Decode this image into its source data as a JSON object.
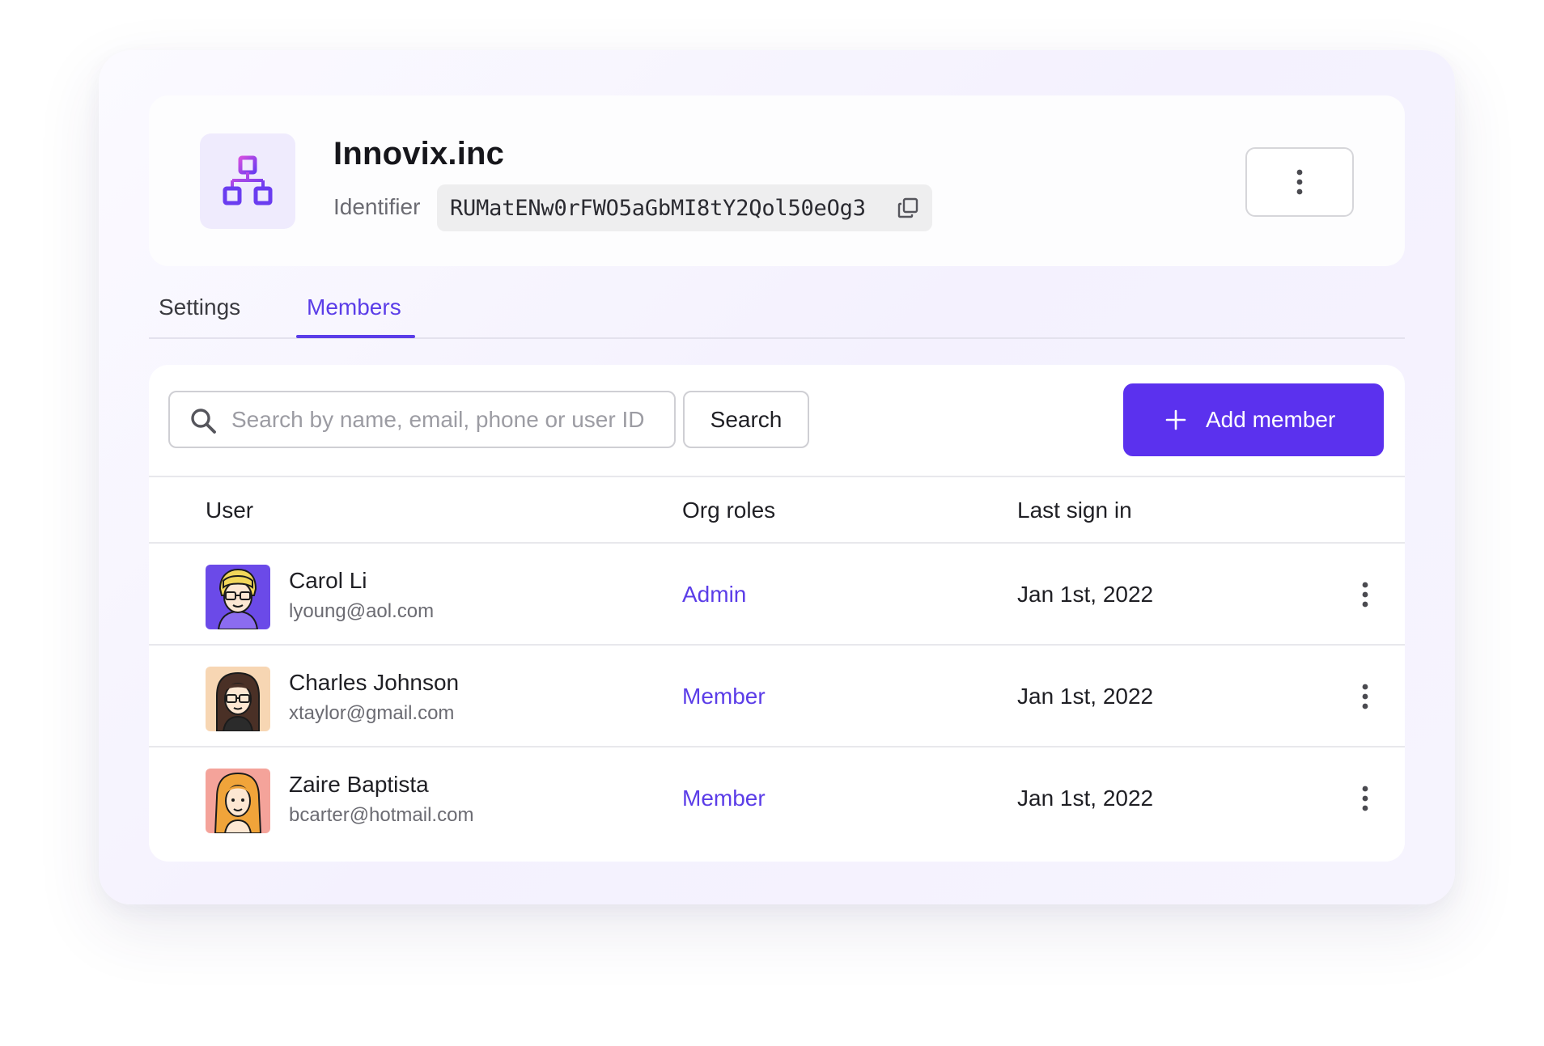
{
  "org": {
    "name": "Innovix.inc",
    "identifier_label": "Identifier",
    "identifier_value": "RUMatENw0rFWO5aGbMI8tY2Qol50eOg3",
    "logo_icon": "org-hierarchy-icon"
  },
  "tabs": [
    {
      "label": "Settings",
      "active": false
    },
    {
      "label": "Members",
      "active": true
    }
  ],
  "toolbar": {
    "search_placeholder": "Search by name, email, phone or user ID",
    "search_value": "",
    "search_button": "Search",
    "add_button": "Add member"
  },
  "table": {
    "headers": {
      "user": "User",
      "roles": "Org roles",
      "last_sign_in": "Last sign in"
    },
    "rows": [
      {
        "name": "Carol Li",
        "email": "lyoung@aol.com",
        "role": "Admin",
        "last_sign_in": "Jan 1st, 2022",
        "avatar_bg": "#6b4ae8"
      },
      {
        "name": "Charles Johnson",
        "email": "xtaylor@gmail.com",
        "role": "Member",
        "last_sign_in": "Jan 1st, 2022",
        "avatar_bg": "#f7d6b3"
      },
      {
        "name": "Zaire Baptista",
        "email": "bcarter@hotmail.com",
        "role": "Member",
        "last_sign_in": "Jan 1st, 2022",
        "avatar_bg": "#f4a39a"
      }
    ]
  },
  "colors": {
    "accent": "#5b31ee",
    "link": "#5b3de8"
  }
}
